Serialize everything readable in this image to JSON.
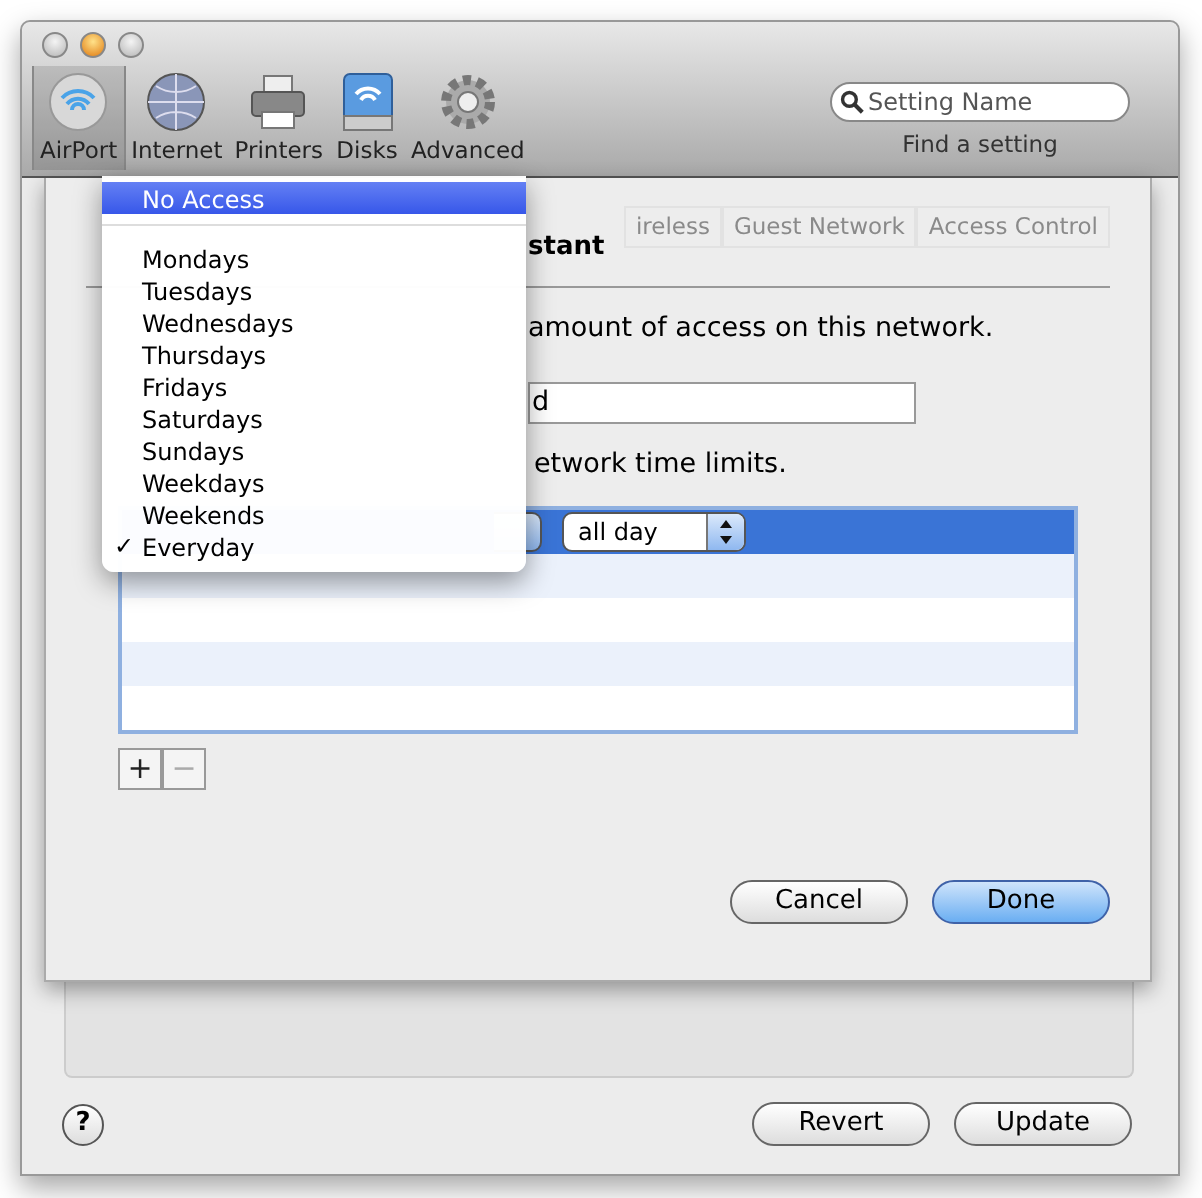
{
  "toolbar": {
    "items": [
      {
        "label": "AirPort",
        "selected": true
      },
      {
        "label": "Internet",
        "selected": false
      },
      {
        "label": "Printers",
        "selected": false
      },
      {
        "label": "Disks",
        "selected": false
      },
      {
        "label": "Advanced",
        "selected": false
      }
    ],
    "search": {
      "placeholder": "Setting Name",
      "caption": "Find a setting"
    }
  },
  "background_tabs": [
    "ireless",
    "Guest Network",
    "Access Control"
  ],
  "sheet": {
    "title": "stant",
    "line_1": "amount of access on this network.",
    "description_value": "d",
    "line_2": "etwork time limits.",
    "rows": [
      {
        "selected": true,
        "time": "all day"
      }
    ],
    "add": "+",
    "remove": {
      "label": "−",
      "disabled": true
    },
    "buttons": [
      {
        "label": "Cancel",
        "kind": "default"
      },
      {
        "label": "Done",
        "kind": "primary"
      }
    ]
  },
  "menu": {
    "check_mark": "✓",
    "items": [
      {
        "kind": "item",
        "label": "No Access",
        "selected": true,
        "checked": false
      },
      {
        "kind": "separator"
      },
      {
        "kind": "item",
        "label": "Mondays",
        "selected": false,
        "checked": false
      },
      {
        "kind": "item",
        "label": "Tuesdays",
        "selected": false,
        "checked": false
      },
      {
        "kind": "item",
        "label": "Wednesdays",
        "selected": false,
        "checked": false
      },
      {
        "kind": "item",
        "label": "Thursdays",
        "selected": false,
        "checked": false
      },
      {
        "kind": "item",
        "label": "Fridays",
        "selected": false,
        "checked": false
      },
      {
        "kind": "item",
        "label": "Saturdays",
        "selected": false,
        "checked": false
      },
      {
        "kind": "item",
        "label": "Sundays",
        "selected": false,
        "checked": false
      },
      {
        "kind": "item",
        "label": "Weekdays",
        "selected": false,
        "checked": false
      },
      {
        "kind": "item",
        "label": "Weekends",
        "selected": false,
        "checked": false
      },
      {
        "kind": "item",
        "label": "Everyday",
        "selected": false,
        "checked": true
      }
    ]
  },
  "footer": {
    "help": "?",
    "buttons": [
      "Revert",
      "Update"
    ]
  }
}
